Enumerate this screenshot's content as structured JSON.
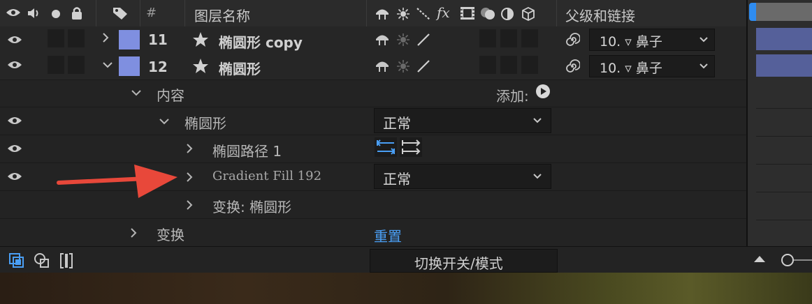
{
  "header": {
    "hash": "#",
    "layer_name": "图层名称",
    "fx": "fx",
    "parent_link": "父级和链接"
  },
  "layers": [
    {
      "number": "11",
      "name": "椭圆形 copy",
      "parent": "10. ▿ 鼻子"
    },
    {
      "number": "12",
      "name": "椭圆形",
      "parent": "10. ▿ 鼻子"
    }
  ],
  "props": {
    "contents": "内容",
    "add_label": "添加:",
    "ellipse_group": "椭圆形",
    "ellipse_blend": "正常",
    "ellipse_path": "椭圆路径 1",
    "gradient_fill": "Gradient Fill 192",
    "gradient_blend": "正常",
    "transform_ellipse": "变换: 椭圆形",
    "transform": "变换",
    "reset": "重置"
  },
  "footer": {
    "toggle_label": "切换开关/模式"
  },
  "colors": {
    "label_color": "#7f8fe0",
    "link_blue": "#4a9ff5",
    "arrow_red": "#e8483a",
    "timeline_bar": "#55609a"
  }
}
